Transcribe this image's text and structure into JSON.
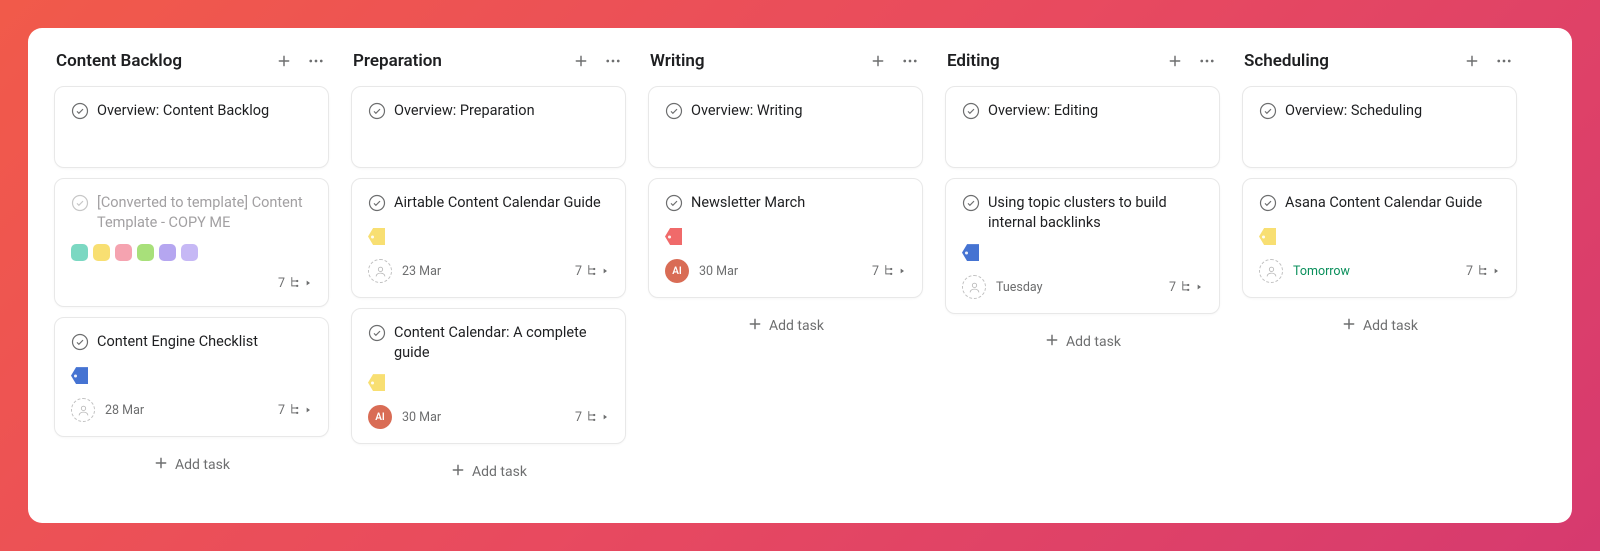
{
  "add_task_label": "Add task",
  "colors": {
    "teal": "#7bd8c2",
    "yellow": "#f8df72",
    "pink": "#f5a3b0",
    "green": "#a8e07a",
    "purple": "#b5a6f0",
    "lilac": "#c6b8f5",
    "red": "#f06a6a",
    "blue": "#4573d2",
    "assignee": "#d96c55"
  },
  "columns": [
    {
      "title": "Content Backlog",
      "cards": [
        {
          "type": "overview",
          "title": "Overview: Content Backlog"
        },
        {
          "type": "task",
          "title": "[Converted to template] Content Template - COPY ME",
          "faded": true,
          "faded_check": true,
          "tags": [
            "teal",
            "yellow",
            "pink",
            "green",
            "purple",
            "lilac"
          ],
          "tag_style": "round",
          "assignee": null,
          "date": null,
          "subtasks": 7
        },
        {
          "type": "task",
          "title": "Content Engine Checklist",
          "tags": [
            "blue"
          ],
          "tag_style": "tagshape",
          "assignee": null,
          "date": "28 Mar",
          "subtasks": 7
        }
      ]
    },
    {
      "title": "Preparation",
      "cards": [
        {
          "type": "overview",
          "title": "Overview: Preparation"
        },
        {
          "type": "task",
          "title": "Airtable Content Calendar Guide",
          "tags": [
            "yellow"
          ],
          "tag_style": "tagshape",
          "assignee": null,
          "date": "23 Mar",
          "subtasks": 7
        },
        {
          "type": "task",
          "title": "Content Calendar: A complete guide",
          "tags": [
            "yellow"
          ],
          "tag_style": "tagshape",
          "assignee": "AI",
          "date": "30 Mar",
          "subtasks": 7
        }
      ]
    },
    {
      "title": "Writing",
      "cards": [
        {
          "type": "overview",
          "title": "Overview: Writing"
        },
        {
          "type": "task",
          "title": "Newsletter March",
          "tags": [
            "red"
          ],
          "tag_style": "tagshape",
          "assignee": "AI",
          "date": "30 Mar",
          "subtasks": 7
        }
      ]
    },
    {
      "title": "Editing",
      "cards": [
        {
          "type": "overview",
          "title": "Overview: Editing"
        },
        {
          "type": "task",
          "title": "Using topic clusters to build internal backlinks",
          "tags": [
            "blue"
          ],
          "tag_style": "tagshape",
          "assignee": null,
          "date": "Tuesday",
          "subtasks": 7
        }
      ]
    },
    {
      "title": "Scheduling",
      "cards": [
        {
          "type": "overview",
          "title": "Overview: Scheduling"
        },
        {
          "type": "task",
          "title": "Asana Content Calendar Guide",
          "tags": [
            "yellow"
          ],
          "tag_style": "tagshape",
          "assignee": null,
          "date": "Tomorrow",
          "date_color": "green",
          "subtasks": 7
        }
      ]
    }
  ]
}
